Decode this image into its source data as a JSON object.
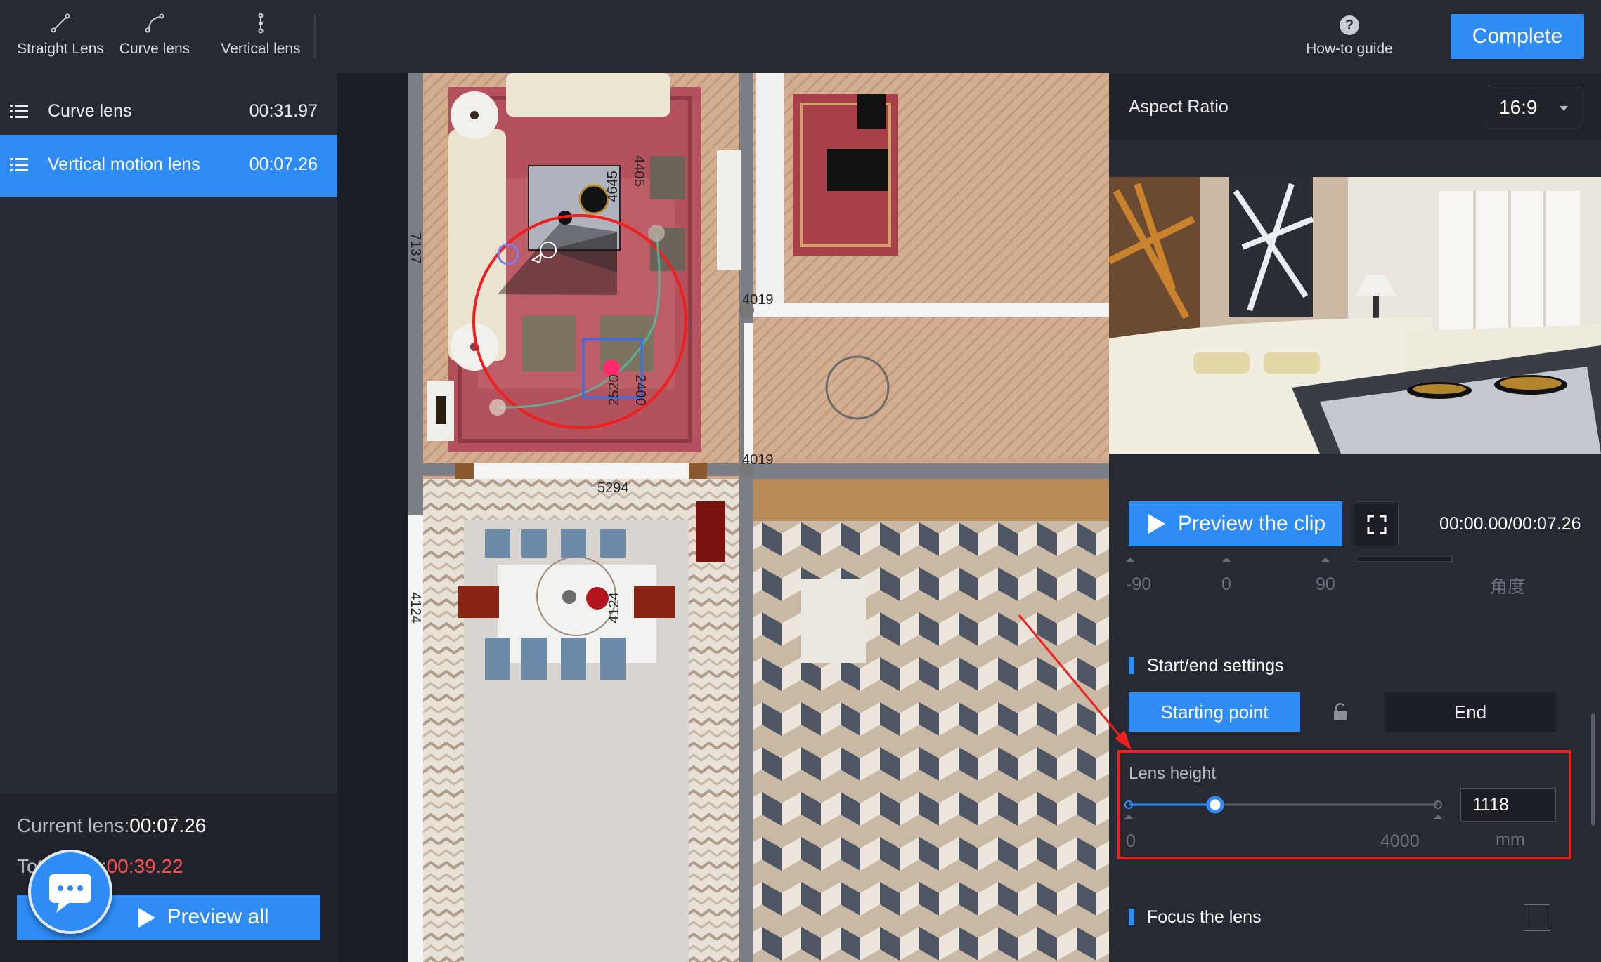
{
  "toolbar": {
    "tools": [
      {
        "label": "Straight Lens",
        "icon": "straight-lens-icon"
      },
      {
        "label": "Curve lens",
        "icon": "curve-lens-icon"
      },
      {
        "label": "Vertical lens",
        "icon": "vertical-lens-icon"
      }
    ],
    "guide_label": "How-to guide",
    "guide_icon": "?",
    "complete_label": "Complete"
  },
  "lenses": [
    {
      "name": "Curve lens",
      "time": "00:31.97",
      "active": false
    },
    {
      "name": "Vertical motion lens",
      "time": "00:07.26",
      "active": true
    }
  ],
  "footer": {
    "current_label": "Current lens:",
    "current_value": "00:07.26",
    "total_label": "Total time:",
    "total_value": "00:39.22",
    "preview_all": "Preview all"
  },
  "plan": {
    "dims": [
      "4645",
      "4405",
      "7137",
      "4019",
      "2520",
      "2400",
      "4019",
      "5294",
      "4124",
      "4124"
    ]
  },
  "panel": {
    "aspect_label": "Aspect Ratio",
    "aspect_value": "16:9",
    "preview_clip": "Preview the clip",
    "time": "00:00.00/00:07.26",
    "angle_ticks": [
      "-90",
      "0",
      "90"
    ],
    "angle_unit": "角度",
    "start_end_title": "Start/end settings",
    "starting_point": "Starting point",
    "end": "End",
    "lens_height_label": "Lens height",
    "lens_height_value": "1118",
    "lens_height_min": "0",
    "lens_height_max": "4000",
    "lens_height_unit": "mm",
    "lens_height_fraction": 0.2795,
    "focus_title": "Focus the lens"
  },
  "colors": {
    "accent": "#2f8cf5",
    "highlight": "#f01f1f",
    "total_time": "#ff4d4d"
  }
}
